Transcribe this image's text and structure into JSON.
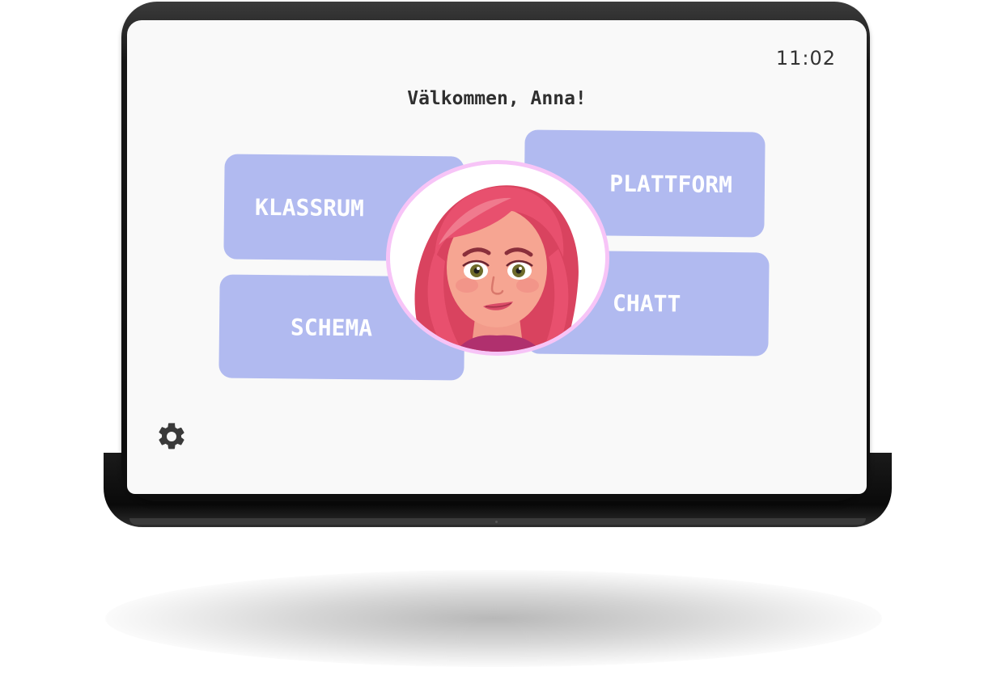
{
  "status_bar": {
    "time": "11:02"
  },
  "header": {
    "welcome": "Välkommen, Anna!"
  },
  "menu": {
    "klassrum": "KLASSRUM",
    "plattform": "PLATTFORM",
    "schema": "SCHEMA",
    "chatt": "CHATT"
  },
  "icons": {
    "avatar": "avatar-girl-pink-hair-icon",
    "settings": "gear-icon"
  },
  "colors": {
    "screen_bg": "#f9f9f9",
    "tile_bg": "#b1baf0",
    "tile_text": "#ffffff",
    "avatar_ring": "#f7c4f7",
    "hair": "#e8506e"
  }
}
